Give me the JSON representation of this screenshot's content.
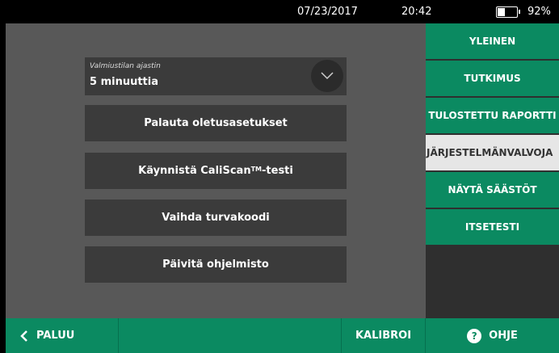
{
  "status": {
    "date": "07/23/2017",
    "time": "20:42",
    "battery_percent": "92%",
    "battery_level": 0.35,
    "battery_icon": "battery-icon"
  },
  "settings": {
    "dropdown_label": "Valmiustilan ajastin",
    "dropdown_value": "5 minuuttia",
    "reset_label": "Palauta oletusasetukset",
    "caliscan_label": "Käynnistä CaliScan",
    "caliscan_tm": "TM",
    "caliscan_suffix": "-testi",
    "passcode_label": "Vaihda turvakoodi",
    "update_label": "Päivitä ohjelmisto"
  },
  "menu": {
    "items": [
      {
        "label": "YLEINEN"
      },
      {
        "label": "TUTKIMUS"
      },
      {
        "label": "TULOSTETTU RAPORTTI"
      },
      {
        "label": "JÄRJESTELMÄNVALVOJA"
      },
      {
        "label": "NÄYTÄ SÄÄSTÖT"
      },
      {
        "label": "ITSETESTI"
      }
    ],
    "active_index": 3
  },
  "bottom": {
    "back_label": "PALUU",
    "calibrate_label": "KALIBROI",
    "help_label": "OHJE",
    "help_icon_glyph": "?"
  },
  "colors": {
    "accent_green": "#0b8a61",
    "panel_gray": "#585858",
    "button_dark": "#3b3b3b",
    "active_menu": "#e6e6e6"
  }
}
